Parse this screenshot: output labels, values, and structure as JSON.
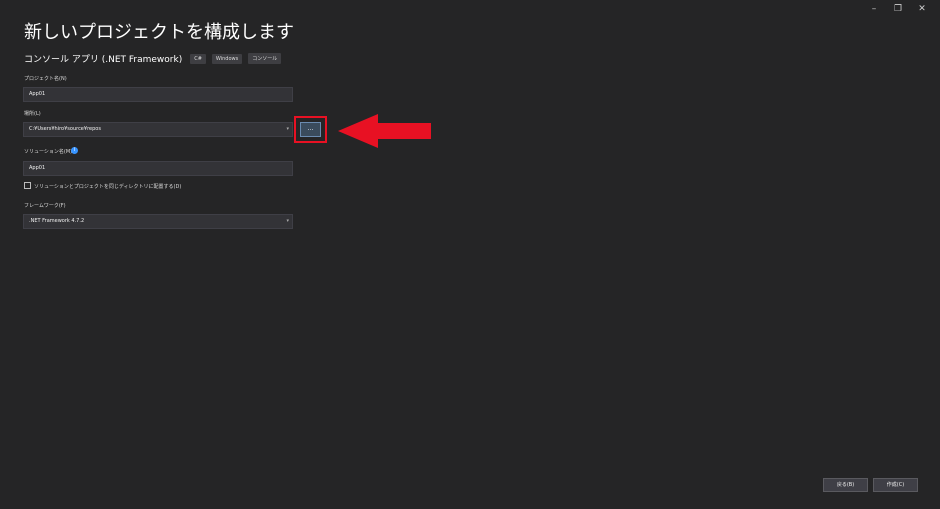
{
  "window": {
    "controls": [
      "–",
      "❐",
      "✕"
    ]
  },
  "header": {
    "title": "新しいプロジェクトを構成します",
    "template_name": "コンソール アプリ (.NET Framework)",
    "tags": [
      "C#",
      "Windows",
      "コンソール"
    ]
  },
  "form": {
    "project_name_label": "プロジェクト名(N)",
    "project_name_value": "App01",
    "location_label": "場所(L)",
    "location_value": "C:¥Users¥hiro¥source¥repos",
    "browse_label": "...",
    "solution_name_label": "ソリューション名(M)",
    "solution_info_icon": "i",
    "solution_name_value": "App01",
    "same_dir_label": "ソリューションとプロジェクトを同じディレクトリに配置する(D)",
    "same_dir_checked": false,
    "framework_label": "フレームワーク(F)",
    "framework_value": ".NET Framework 4.7.2"
  },
  "footer": {
    "back_label": "戻る(B)",
    "create_label": "作成(C)"
  },
  "colors": {
    "annotation": "#e81123",
    "background": "#252526"
  }
}
